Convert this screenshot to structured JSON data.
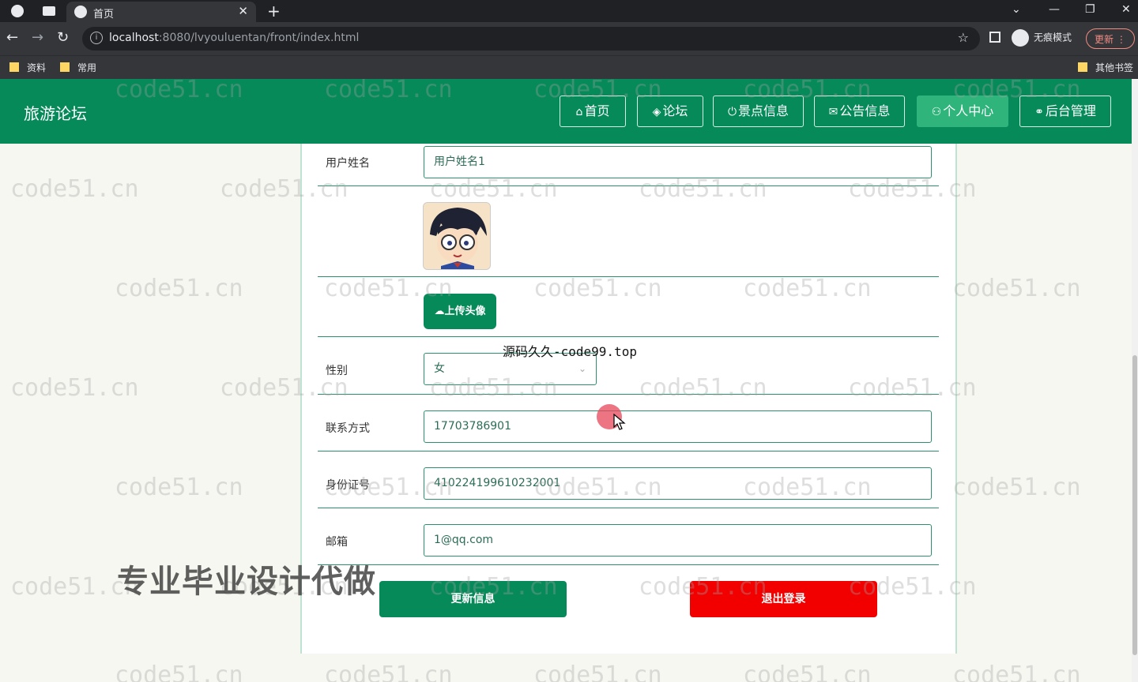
{
  "browser": {
    "tab_title": "首页",
    "url_host": "localhost",
    "url_rest": ":8080/lvyouluentan/front/index.html",
    "incognito_label": "无痕模式",
    "update_label": "更新",
    "bookmarks": [
      "资料",
      "常用"
    ],
    "other_bookmarks": "其他书签"
  },
  "site": {
    "title": "旅游论坛",
    "nav": [
      {
        "label": "首页",
        "icon": "home-icon",
        "glyph": "⌂"
      },
      {
        "label": "论坛",
        "icon": "layers-icon",
        "glyph": "◈"
      },
      {
        "label": "景点信息",
        "icon": "power-icon",
        "glyph": "⏻"
      },
      {
        "label": "公告信息",
        "icon": "mail-icon",
        "glyph": "✉"
      },
      {
        "label": "个人中心",
        "icon": "user-icon",
        "glyph": "⚇"
      },
      {
        "label": "后台管理",
        "icon": "link-icon",
        "glyph": "🔗"
      }
    ],
    "active_nav": "个人中心"
  },
  "form": {
    "name_label": "用户姓名",
    "name_value": "用户姓名1",
    "upload_label": "上传头像",
    "gender_label": "性别",
    "gender_value": "女",
    "phone_label": "联系方式",
    "phone_value": "17703786901",
    "id_label": "身份证号",
    "id_value": "410224199610232001",
    "email_label": "邮箱",
    "email_value": "1@qq.com",
    "update_button": "更新信息",
    "logout_button": "退出登录"
  },
  "overlays": {
    "watermark": "code51.cn",
    "watermark_top": "源码久久-code99.top",
    "ad_text": "专业毕业设计代做"
  },
  "colors": {
    "brand_green": "#068a5a",
    "active_nav": "#2fb57b",
    "logout_red": "#f20000"
  }
}
